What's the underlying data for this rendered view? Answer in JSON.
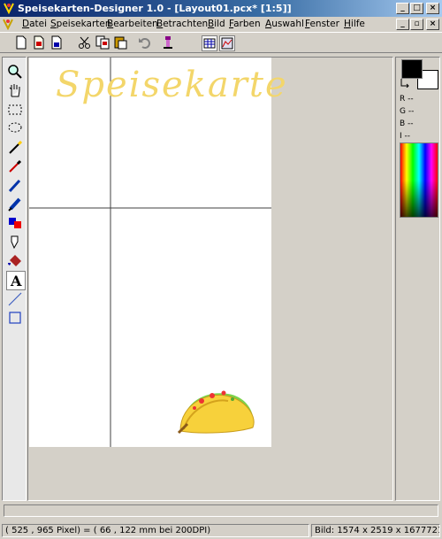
{
  "window": {
    "title": "Speisekarten-Designer 1.0 - [Layout01.pcx* [1:5]]"
  },
  "title_buttons": {
    "minimize": "_",
    "maximize": "□",
    "close": "×"
  },
  "mdi_buttons": {
    "minimize": "_",
    "restore": "▫",
    "close": "×"
  },
  "menu": [
    {
      "accel": "D",
      "rest": "atei"
    },
    {
      "accel": "S",
      "rest": "peisekarten"
    },
    {
      "accel": "B",
      "rest": "earbeiten"
    },
    {
      "accel": "B",
      "rest": "etrachten"
    },
    {
      "accel": "B",
      "rest": "ild"
    },
    {
      "accel": "F",
      "rest": "arben"
    },
    {
      "accel": "A",
      "rest": "uswahl"
    },
    {
      "accel": "F",
      "rest": "enster"
    },
    {
      "accel": "H",
      "rest": "ilfe"
    }
  ],
  "toolbar": {
    "icons": [
      "new-icon",
      "open-icon",
      "save-icon",
      "cut-icon",
      "copy-icon",
      "paste-icon",
      "undo-icon",
      "crop-icon",
      "grid-icon",
      "histogram-icon"
    ]
  },
  "tools": [
    "zoom-tool-icon",
    "hand-tool-icon",
    "rect-select-icon",
    "lasso-select-icon",
    "magic-wand-icon",
    "eyedropper-icon",
    "pencil-icon",
    "brush-icon",
    "color-replace-icon",
    "airbrush-icon",
    "fill-bucket-icon",
    "text-tool-icon",
    "line-tool-icon",
    "rectangle-tool-icon"
  ],
  "document": {
    "heading": "Speisekarte"
  },
  "colors": {
    "foreground": "#000000",
    "background": "#ffffff",
    "heading": "#f3d66a",
    "r_label": "R --",
    "g_label": "G --",
    "b_label": "B --",
    "i_label": "I --"
  },
  "status": {
    "position": "( 525 , 965 Pixel) = ( 66 , 122 mm bei 200DPI)",
    "image_info": "Bild: 1574 x 2519 x 16777216"
  }
}
